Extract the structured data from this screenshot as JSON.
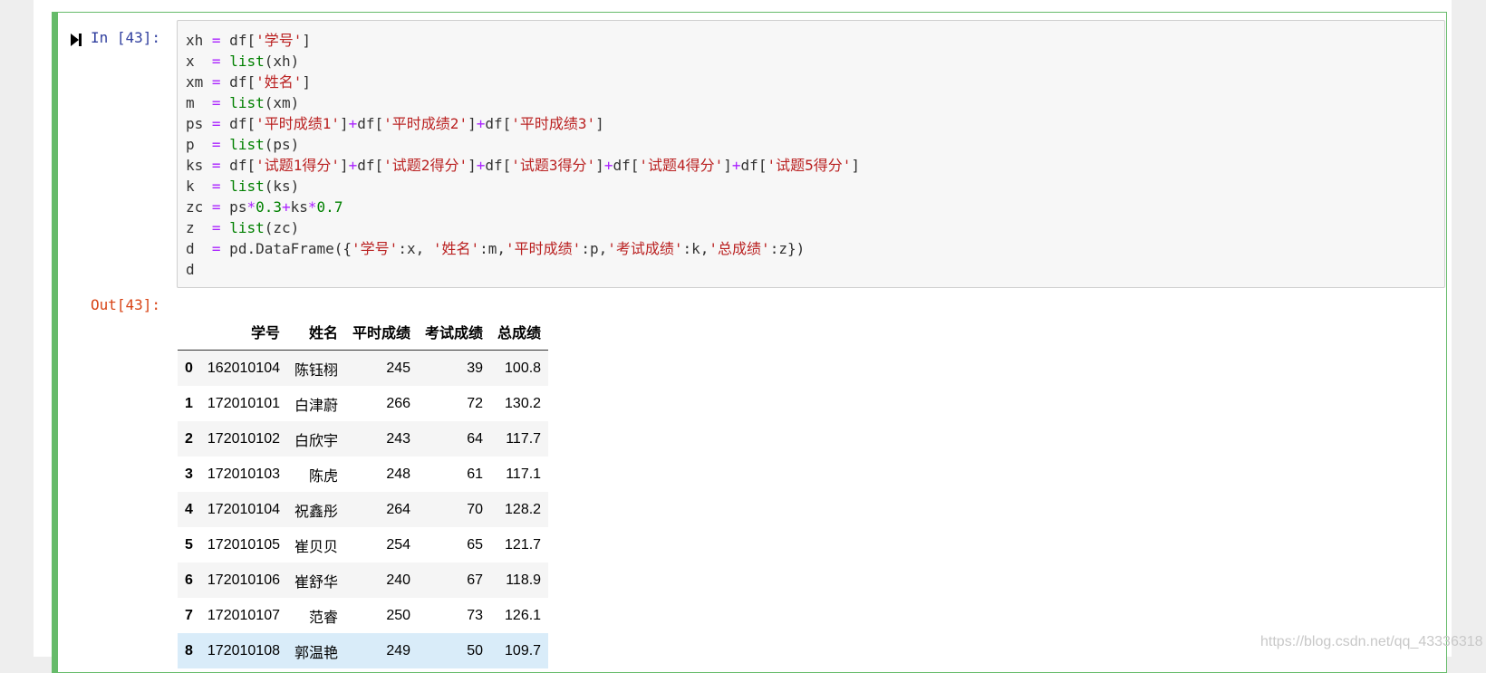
{
  "cell": {
    "in_prompt": "In  [43]:",
    "out_prompt": "Out[43]:"
  },
  "code_lines": [
    [
      [
        "xh ",
        "pl"
      ],
      [
        "=",
        "op"
      ],
      [
        " df[",
        "pl"
      ],
      [
        "'学号'",
        "str"
      ],
      [
        "]",
        "pl"
      ]
    ],
    [
      [
        "x  ",
        "pl"
      ],
      [
        "=",
        "op"
      ],
      [
        " ",
        "pl"
      ],
      [
        "list",
        "kw"
      ],
      [
        "(xh)",
        "pl"
      ]
    ],
    [
      [
        "xm ",
        "pl"
      ],
      [
        "=",
        "op"
      ],
      [
        " df[",
        "pl"
      ],
      [
        "'姓名'",
        "str"
      ],
      [
        "]",
        "pl"
      ]
    ],
    [
      [
        "m  ",
        "pl"
      ],
      [
        "=",
        "op"
      ],
      [
        " ",
        "pl"
      ],
      [
        "list",
        "kw"
      ],
      [
        "(xm)",
        "pl"
      ]
    ],
    [
      [
        "ps ",
        "pl"
      ],
      [
        "=",
        "op"
      ],
      [
        " df[",
        "pl"
      ],
      [
        "'平时成绩1'",
        "str"
      ],
      [
        "]",
        "pl"
      ],
      [
        "+",
        "op"
      ],
      [
        "df[",
        "pl"
      ],
      [
        "'平时成绩2'",
        "str"
      ],
      [
        "]",
        "pl"
      ],
      [
        "+",
        "op"
      ],
      [
        "df[",
        "pl"
      ],
      [
        "'平时成绩3'",
        "str"
      ],
      [
        "]",
        "pl"
      ]
    ],
    [
      [
        "p  ",
        "pl"
      ],
      [
        "=",
        "op"
      ],
      [
        " ",
        "pl"
      ],
      [
        "list",
        "kw"
      ],
      [
        "(ps)",
        "pl"
      ]
    ],
    [
      [
        "ks ",
        "pl"
      ],
      [
        "=",
        "op"
      ],
      [
        " df[",
        "pl"
      ],
      [
        "'试题1得分'",
        "str"
      ],
      [
        "]",
        "pl"
      ],
      [
        "+",
        "op"
      ],
      [
        "df[",
        "pl"
      ],
      [
        "'试题2得分'",
        "str"
      ],
      [
        "]",
        "pl"
      ],
      [
        "+",
        "op"
      ],
      [
        "df[",
        "pl"
      ],
      [
        "'试题3得分'",
        "str"
      ],
      [
        "]",
        "pl"
      ],
      [
        "+",
        "op"
      ],
      [
        "df[",
        "pl"
      ],
      [
        "'试题4得分'",
        "str"
      ],
      [
        "]",
        "pl"
      ],
      [
        "+",
        "op"
      ],
      [
        "df[",
        "pl"
      ],
      [
        "'试题5得分'",
        "str"
      ],
      [
        "]",
        "pl"
      ]
    ],
    [
      [
        "k  ",
        "pl"
      ],
      [
        "=",
        "op"
      ],
      [
        " ",
        "pl"
      ],
      [
        "list",
        "kw"
      ],
      [
        "(ks)",
        "pl"
      ]
    ],
    [
      [
        "zc ",
        "pl"
      ],
      [
        "=",
        "op"
      ],
      [
        " ps",
        "pl"
      ],
      [
        "*",
        "op"
      ],
      [
        "0.3",
        "num"
      ],
      [
        "+",
        "op"
      ],
      [
        "ks",
        "pl"
      ],
      [
        "*",
        "op"
      ],
      [
        "0.7",
        "num"
      ]
    ],
    [
      [
        "z  ",
        "pl"
      ],
      [
        "=",
        "op"
      ],
      [
        " ",
        "pl"
      ],
      [
        "list",
        "kw"
      ],
      [
        "(zc)",
        "pl"
      ]
    ],
    [
      [
        "d  ",
        "pl"
      ],
      [
        "=",
        "op"
      ],
      [
        " pd.DataFrame({",
        "pl"
      ],
      [
        "'学号'",
        "str"
      ],
      [
        ":x, ",
        "pl"
      ],
      [
        "'姓名'",
        "str"
      ],
      [
        ":m,",
        "pl"
      ],
      [
        "'平时成绩'",
        "str"
      ],
      [
        ":p,",
        "pl"
      ],
      [
        "'考试成绩'",
        "str"
      ],
      [
        ":k,",
        "pl"
      ],
      [
        "'总成绩'",
        "str"
      ],
      [
        ":z})",
        "pl"
      ]
    ],
    [
      [
        "d",
        "pl"
      ]
    ]
  ],
  "table": {
    "columns": [
      "",
      "学号",
      "姓名",
      "平时成绩",
      "考试成绩",
      "总成绩"
    ],
    "rows": [
      [
        "0",
        "162010104",
        "陈钰栩",
        "245",
        "39",
        "100.8"
      ],
      [
        "1",
        "172010101",
        "白津蔚",
        "266",
        "72",
        "130.2"
      ],
      [
        "2",
        "172010102",
        "白欣宇",
        "243",
        "64",
        "117.7"
      ],
      [
        "3",
        "172010103",
        "陈虎",
        "248",
        "61",
        "117.1"
      ],
      [
        "4",
        "172010104",
        "祝鑫彤",
        "264",
        "70",
        "128.2"
      ],
      [
        "5",
        "172010105",
        "崔贝贝",
        "254",
        "65",
        "121.7"
      ],
      [
        "6",
        "172010106",
        "崔舒华",
        "240",
        "67",
        "118.9"
      ],
      [
        "7",
        "172010107",
        "范睿",
        "250",
        "73",
        "126.1"
      ],
      [
        "8",
        "172010108",
        "郭温艳",
        "249",
        "50",
        "109.7"
      ]
    ],
    "hover_row": 8
  },
  "watermark": "https://blog.csdn.net/qq_43336318",
  "colors": {
    "cell_border": "#66bb6a",
    "in_prompt": "#303f9f",
    "out_prompt": "#d84315",
    "keyword": "#008000",
    "string": "#ba2121",
    "operator": "#aa22ff",
    "hover_row": "#d9ecf9"
  }
}
